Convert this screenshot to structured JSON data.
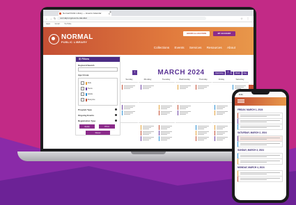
{
  "browser": {
    "tab_title": "Normal Public Library — Events Calendar",
    "url": "normalpl.org/events-calendar",
    "bookmarks": [
      "Apps",
      "Gmail",
      "YouTube"
    ]
  },
  "site": {
    "logo_title": "NORMAL",
    "logo_subtitle": "PUBLIC LIBRARY",
    "hours_button": "HOURS & LOCATION",
    "account_button": "MY ACCOUNT",
    "nav": [
      "Collections",
      "Events",
      "Services",
      "Resources",
      "About"
    ]
  },
  "filters": {
    "header": "Filters",
    "keyword_label": "Keyword Search",
    "age_group_label": "Age Group",
    "age_groups": [
      {
        "label": "Kids",
        "color": "#e3a13b"
      },
      {
        "label": "Teens",
        "color": "#6a3fa0"
      },
      {
        "label": "Adults",
        "color": "#2c8fd3"
      },
      {
        "label": "Everyone",
        "color": "#c44f34"
      }
    ],
    "program_type_label": "Program Type",
    "ongoing_events_label": "Ongoing Events",
    "registration_type_label": "Registration Type",
    "apply_button": "Apply",
    "print_button": "Print",
    "reset_button": "Reset"
  },
  "calendar": {
    "view_buttons": [
      "Upcoming",
      "Month",
      "Week",
      "Day"
    ],
    "month_title": "MARCH 2024",
    "prev": "‹",
    "next": "›",
    "weekdays": [
      "Sunday",
      "Monday",
      "Tuesday",
      "Wednesday",
      "Thursday",
      "Friday",
      "Saturday"
    ]
  },
  "phone": {
    "time": "9:41",
    "days": [
      "FRIDAY, MARCH 1, 2024",
      "SATURDAY, MARCH 2, 2024",
      "SUNDAY, MARCH 3, 2024",
      "MONDAY, MARCH 4, 2024"
    ]
  },
  "colors": {
    "accent": "#c44f34",
    "brand_purple": "#5d3696",
    "button_purple": "#8b2b8a"
  }
}
